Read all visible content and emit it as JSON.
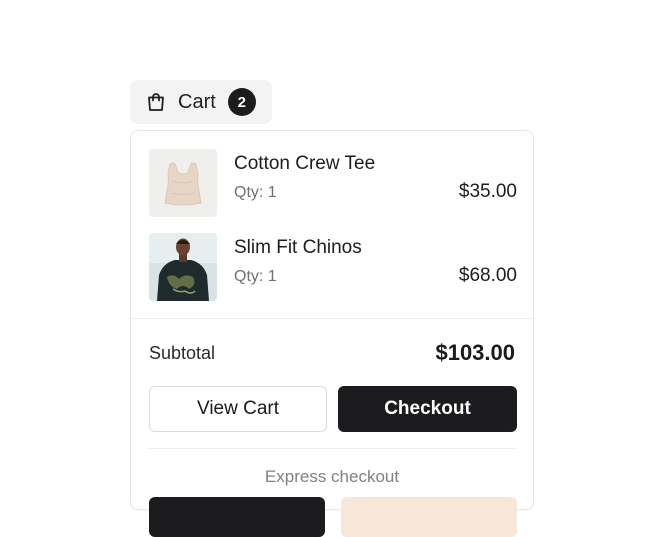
{
  "cart": {
    "label": "Cart",
    "count": "2",
    "icon": "shopping-bag-icon"
  },
  "items": [
    {
      "name": "Cotton Crew Tee",
      "qty": "Qty: 1",
      "price": "$35.00",
      "thumb_icon": "cotton-crew-tee-image"
    },
    {
      "name": "Slim Fit Chinos",
      "qty": "Qty: 1",
      "price": "$68.00",
      "thumb_icon": "slim-fit-chinos-image"
    }
  ],
  "summary": {
    "subtotal_label": "Subtotal",
    "subtotal_value": "$103.00"
  },
  "actions": {
    "view_cart": "View Cart",
    "checkout": "Checkout"
  },
  "express": {
    "label": "Express checkout"
  },
  "colors": {
    "primary": "#1c1c1e",
    "badge": "#1c1c1e",
    "muted_text": "#707075",
    "border": "#e6e6e8",
    "express_secondary": "#f6e7d8"
  }
}
